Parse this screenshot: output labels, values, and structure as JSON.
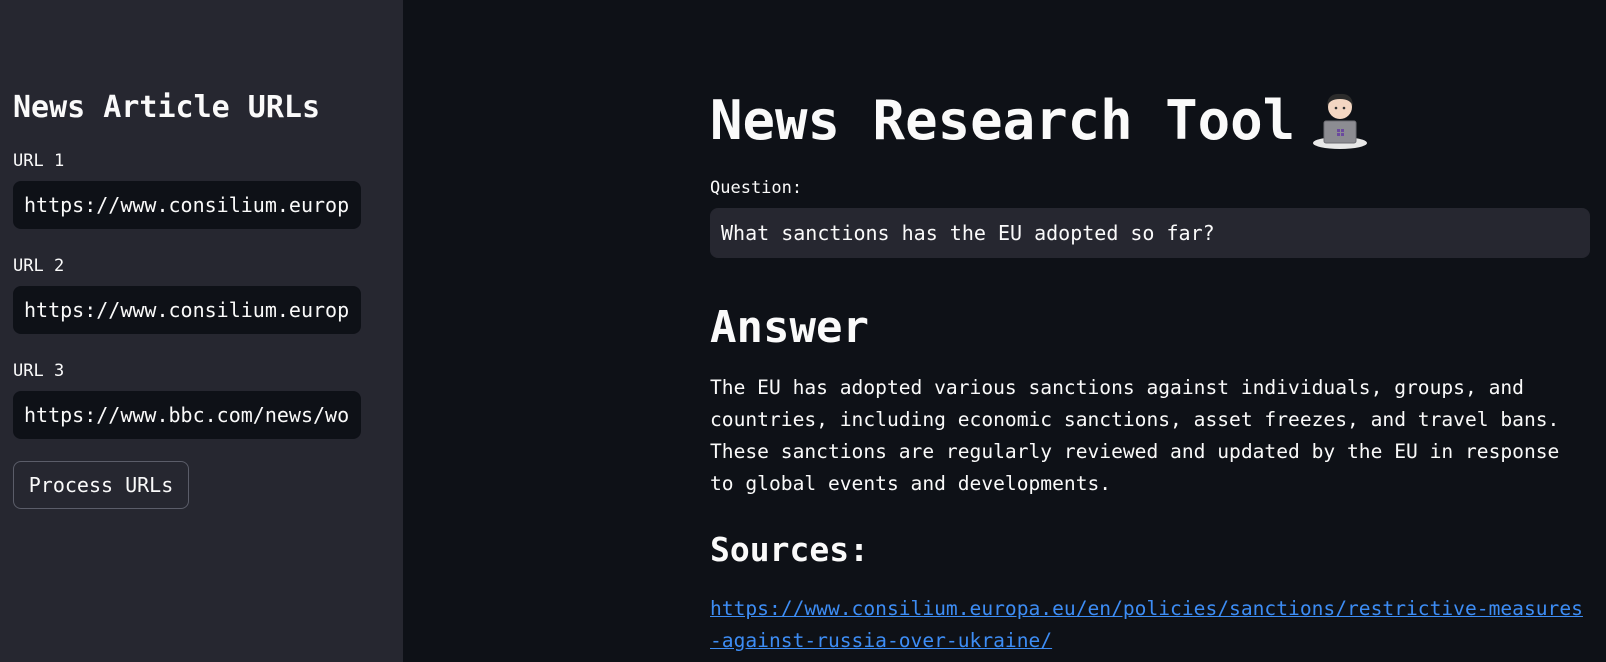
{
  "sidebar": {
    "title": "News Article URLs",
    "urls": [
      {
        "label": "URL 1",
        "value": "https://www.consilium.europa"
      },
      {
        "label": "URL 2",
        "value": "https://www.consilium.europa"
      },
      {
        "label": "URL 3",
        "value": "https://www.bbc.com/news/wor"
      }
    ],
    "process_button": "Process URLs"
  },
  "main": {
    "title": "News Research Tool",
    "title_icon": "woman-technologist-icon",
    "question_label": "Question:",
    "question_value": "What sanctions has the EU adopted so far?",
    "answer_heading": "Answer",
    "answer_text": "The EU has adopted various sanctions against individuals, groups, and countries, including economic sanctions, asset freezes, and travel bans. These sanctions are regularly reviewed and updated by the EU in response to global events and developments.",
    "sources_heading": "Sources:",
    "source_link": "https://www.consilium.europa.eu/en/policies/sanctions/restrictive-measures-against-russia-over-ukraine/"
  },
  "colors": {
    "background": "#0e1117",
    "sidebar": "#262730",
    "link": "#3d8df5"
  }
}
